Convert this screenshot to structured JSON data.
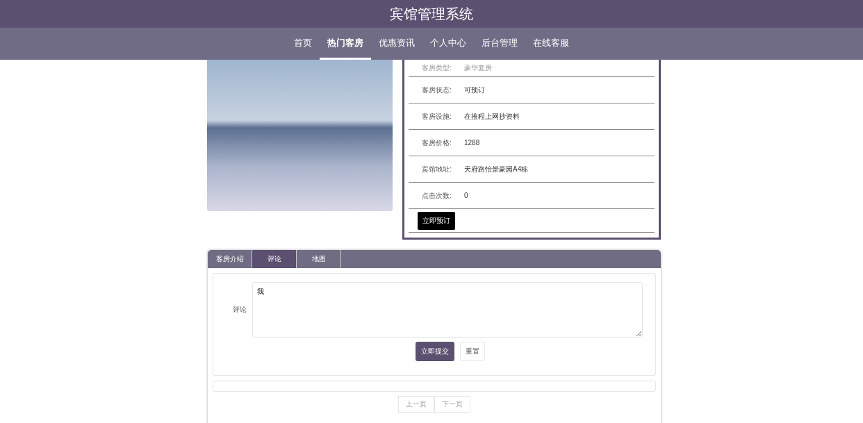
{
  "header": {
    "title": "宾馆管理系统"
  },
  "nav": [
    {
      "label": "首页",
      "selected": false
    },
    {
      "label": "热门客房",
      "selected": true
    },
    {
      "label": "优惠资讯",
      "selected": false
    },
    {
      "label": "个人中心",
      "selected": false
    },
    {
      "label": "后台管理",
      "selected": false
    },
    {
      "label": "在线客服",
      "selected": false
    }
  ],
  "room": {
    "details": [
      {
        "label": "客房类型:",
        "value": "豪华套房"
      },
      {
        "label": "客房状态:",
        "value": "可预订"
      },
      {
        "label": "客房设施:",
        "value": "在推程上网抄资料"
      },
      {
        "label": "客房价格:",
        "value": "1288"
      },
      {
        "label": "宾馆地址:",
        "value": "天府路怡景豪园A4栋"
      },
      {
        "label": "点击次数:",
        "value": "0"
      }
    ],
    "book_button": "立即预订"
  },
  "tabs": [
    {
      "label": "客房介绍",
      "selected": false
    },
    {
      "label": "评论",
      "selected": true
    },
    {
      "label": "地图",
      "selected": false
    }
  ],
  "comment_form": {
    "label": "评论",
    "value": "我",
    "submit": "立即提交",
    "reset": "重置"
  },
  "pagination": [
    {
      "label": "上一页",
      "disabled": true
    },
    {
      "label": "下一页",
      "disabled": true
    }
  ]
}
